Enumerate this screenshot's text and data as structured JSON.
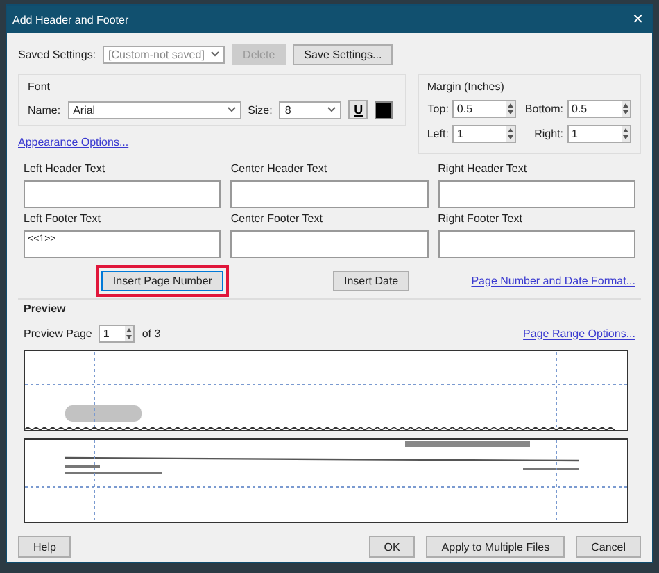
{
  "window": {
    "title": "Add Header and Footer",
    "close": "✕"
  },
  "saved_settings": {
    "label": "Saved Settings:",
    "value": "[Custom-not saved]",
    "delete": {
      "label": "Delete",
      "disabled": true
    },
    "save": "Save Settings..."
  },
  "font": {
    "title": "Font",
    "name_label": "Name:",
    "name": "Arial",
    "size_label": "Size:",
    "size": "8",
    "underline": "U",
    "color": "#000000"
  },
  "appearance_link": "Appearance Options...",
  "margin": {
    "title": "Margin (Inches)",
    "fields": [
      {
        "label": "Top:",
        "value": "0.5"
      },
      {
        "label": "Bottom:",
        "value": "0.5"
      },
      {
        "label": "Left:",
        "value": "1"
      },
      {
        "label": "Right:",
        "value": "1"
      }
    ]
  },
  "header_fields": [
    {
      "label": "Left Header Text"
    },
    {
      "label": "Center Header Text"
    },
    {
      "label": "Right Header Text"
    }
  ],
  "footer_fields": [
    {
      "label": "Left Footer Text",
      "value": "<<1>>"
    },
    {
      "label": "Center Footer Text"
    },
    {
      "label": "Right Footer Text"
    }
  ],
  "insert_page_number": {
    "label": "Insert Page Number",
    "highlighted": true
  },
  "insert_date": "Insert Date",
  "format_link": "Page Number and Date Format...",
  "preview": {
    "title": "Preview",
    "page_label": "Preview Page",
    "page": "1",
    "of": "of 3",
    "range_link": "Page Range Options..."
  },
  "buttons": {
    "help": "Help",
    "ok": "OK",
    "apply": "Apply to Multiple Files",
    "cancel": "Cancel"
  }
}
